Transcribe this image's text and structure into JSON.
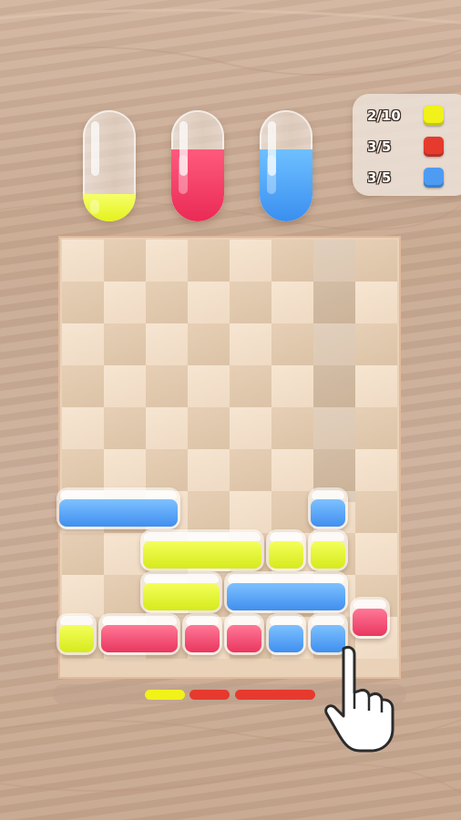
{
  "colors": {
    "yellow": "#e9f51f",
    "red": "#ef3f66",
    "blue": "#4d9cf2",
    "accent_red": "#e63a2e"
  },
  "tubes": [
    {
      "name": "yellow-tube",
      "color": "yellow",
      "fill": 0.25
    },
    {
      "name": "red-tube",
      "color": "red",
      "fill": 0.65
    },
    {
      "name": "blue-tube",
      "color": "blue",
      "fill": 0.65
    }
  ],
  "goals": [
    {
      "progress": "2/10",
      "color": "yellow",
      "icon": "yellow-square-icon"
    },
    {
      "progress": "3/5",
      "color": "red",
      "icon": "red-square-icon"
    },
    {
      "progress": "3/5",
      "color": "blue",
      "icon": "blue-square-icon"
    }
  ],
  "board": {
    "cols": 8,
    "rows": 10,
    "highlight_col": 6
  },
  "blocks": [
    {
      "color": "blue",
      "col": 0,
      "row": 6,
      "span": 3
    },
    {
      "color": "blue",
      "col": 6,
      "row": 6,
      "span": 1
    },
    {
      "color": "yellow",
      "col": 2,
      "row": 7,
      "span": 3
    },
    {
      "color": "yellow",
      "col": 5,
      "row": 7,
      "span": 1
    },
    {
      "color": "yellow",
      "col": 6,
      "row": 7,
      "span": 1
    },
    {
      "color": "yellow",
      "col": 2,
      "row": 8,
      "span": 2
    },
    {
      "color": "blue",
      "col": 4,
      "row": 8,
      "span": 3
    },
    {
      "color": "red",
      "col": 7,
      "row": 8.6,
      "span": 1
    },
    {
      "color": "yellow",
      "col": 0,
      "row": 9,
      "span": 1
    },
    {
      "color": "red",
      "col": 1,
      "row": 9,
      "span": 2
    },
    {
      "color": "red",
      "col": 3,
      "row": 9,
      "span": 1
    },
    {
      "color": "red",
      "col": 4,
      "row": 9,
      "span": 1
    },
    {
      "color": "blue",
      "col": 5,
      "row": 9,
      "span": 1
    },
    {
      "color": "blue",
      "col": 6,
      "row": 9,
      "span": 1
    }
  ],
  "queue": [
    {
      "color": "yellow",
      "length": 1
    },
    {
      "color": "accent_red",
      "length": 1
    },
    {
      "color": "accent_red",
      "length": 2
    }
  ],
  "hand_icon": "pointing-hand-icon"
}
